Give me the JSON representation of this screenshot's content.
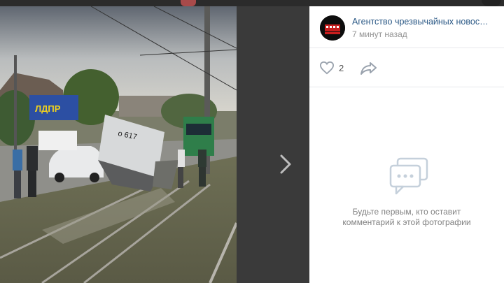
{
  "viewer": {
    "photo_alt": "ДТП с грузовиком на трамвайных путях",
    "billboard_text": "ЛДПР",
    "truck_plate": "о 617"
  },
  "post": {
    "author_name": "Агентство чрезвычайных новостей",
    "time_ago": "7 минут назад",
    "likes": "2"
  },
  "comments": {
    "empty_line1": "Будьте первым, кто оставит",
    "empty_line2": "комментарий к этой фотографии"
  },
  "colors": {
    "link": "#2a5885",
    "muted": "#939393",
    "icon": "#99a2ad"
  },
  "icons": {
    "like": "heart-icon",
    "share": "share-arrow-icon",
    "next": "chevron-right-icon",
    "empty": "comment-bubble-icon"
  }
}
